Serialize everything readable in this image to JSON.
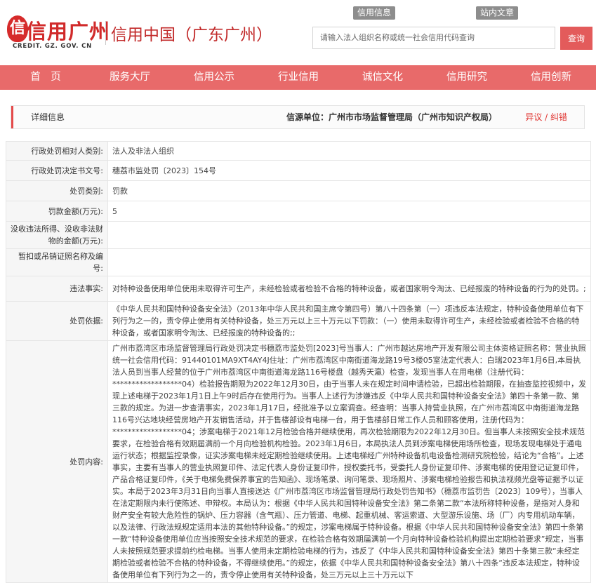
{
  "header": {
    "logo_text": "信用广州",
    "logo_sub": "CREDIT. GZ. GOV. CN",
    "site_subtitle": "信用中国（广东广州）",
    "top_links": [
      "信用信息",
      "站内文章"
    ],
    "search_placeholder": "请输入法人组织名称或统一社会信用代码查询",
    "search_button": "查询"
  },
  "nav": {
    "items": [
      "首　页",
      "服务大厅",
      "信用公示",
      "行业信用",
      "诚信文化",
      "信用研究",
      "信用创新"
    ]
  },
  "panel": {
    "title": "详细信息",
    "source": "信源单位：广州市市场监督管理局（广州市知识产权局）",
    "feedback": "异议 / 纠错"
  },
  "record": {
    "rows": [
      {
        "label": "行政处罚相对人类别:",
        "value": "法人及非法人组织"
      },
      {
        "label": "行政处罚决定书文号:",
        "value": "穗荔市监处罚〔2023〕154号"
      },
      {
        "label": "处罚类别:",
        "value": "罚款"
      },
      {
        "label": "罚款金额(万元):",
        "value": "5"
      },
      {
        "label": "没收违法所得、没收非法财物的金额(万元):",
        "value": ""
      },
      {
        "label": "暂扣或吊销证照名称及编号:",
        "value": ""
      },
      {
        "label": "违法事实:",
        "value": "对特种设备使用单位使用未取得许可生产，未经检验或者检验不合格的特种设备，或者国家明令淘汰、已经报废的特种设备的行为的处罚。;"
      },
      {
        "label": "处罚依据:",
        "value": "《中华人民共和国特种设备安全法》（2013年中华人民共和国主席令第四号）第八十四条第（一）项违反本法规定，特种设备使用单位有下列行为之一的，责令停止使用有关特种设备，处三万元以上三十万元以下罚款：（一）使用未取得许可生产，未经检验或者检验不合格的特种设备，或者国家明令淘汰、已经报废的特种设备的;;"
      },
      {
        "label": "处罚内容:",
        "value": "广州市荔湾区市场监督管理局行政处罚决定书穗荔市监处罚[2023]号当事人：广州市越达房地产开发有限公司主体资格证照名称：营业执照统一社会信用代码：91440101MA9XT4AY4J住址：广州市荔湾区中南街道海龙路19号3楼05室法定代表人：白瑞2023年1月6日,本局执法人员到当事人经营的位于广州市荔湾区中南街道海龙路116号楼盘（越秀天瀛）检查，发现当事人在用电梯（注册代码：******************04）检验报告期限为2022年12月30日，由于当事人未在规定时间申请检验，已超出检验期限，在抽查监控视频中，发现上述电梯于2023年1月1日上午9时后存在使用行为。当事人上述行为涉嫌违反《中华人民共和国特种设备安全法》第四十条第一款、第三款的规定。为进一步查清事实，2023年1月17日，经批准予以立案调查。经查明：当事人持营业执照，在广州市荔湾区中南街道海龙路116号兴达地块经营房地产开发销售活动，并于售楼部设有电梯一台，用于售楼部日常工作人员和顾客使用，注册代码为：******************04；涉案电梯于2021年12月检验合格并继续使用，再次检验期限为2022年12月30日。但当事人未按照安全技术规范要求，在检验合格有效期届满前一个月向检验机构检验。2023年1月6日，本局执法人员到涉案电梯使用场所检查，现场发现电梯处于通电运行状态；根据监控录像，证实涉案电梯未经定期检验继续使用。上述电梯经广州特种设备机电设备检测研究院检验，结论为“合格”。上述事实，主要有当事人的营业执照复印件、法定代表人身份证复印件，授权委托书，受委托人身份证复印件、涉案电梯的使用登记证复印件，产品合格证复印件，《关于电梯免费保养事宜的告知函》、现场笔录、询问笔录、现场照片、涉案电梯检验报告和执法视频光盘等证据予以证实。本局于2023年3月31日向当事人直接送达《广州市荔湾区市场监督管理局行政处罚告知书》（穗荔市监罚告〔2023〕109号），当事人在法定期限内未行使陈述、申辩权。本局认为：根据《中华人民共和国特种设备安全法》第二条第二款“本法所称特种设备，是指对人身和财产安全有较大危险性的锅炉、压力容器（含气瓶）、压力管道、电梯、起重机械、客运索道、大型游乐设施、场（厂）内专用机动车辆，以及法律、行政法规规定适用本法的其他特种设备。”的规定，涉案电梯属于特种设备。根据《中华人民共和国特种设备安全法》第四十条第一款“特种设备使用单位应当按照安全技术规范的要求，在检验合格有效期届满前一个月向特种设备检验机构提出定期检验要求”规定，当事人未按照规范要求提前约检电梯。当事人使用未定期检验电梯的行为，违反了《中华人民共和国特种设备安全法》第四十条第三款“未经定期检验或者检验不合格的特种设备，不得继续使用。”的规定，依据《中华人民共和国特种设备安全法》第八十四条“违反本法规定，特种设备使用单位有下列行为之一的，责令停止使用有关特种设备，处三万元以上三十万元以下"
      }
    ]
  }
}
